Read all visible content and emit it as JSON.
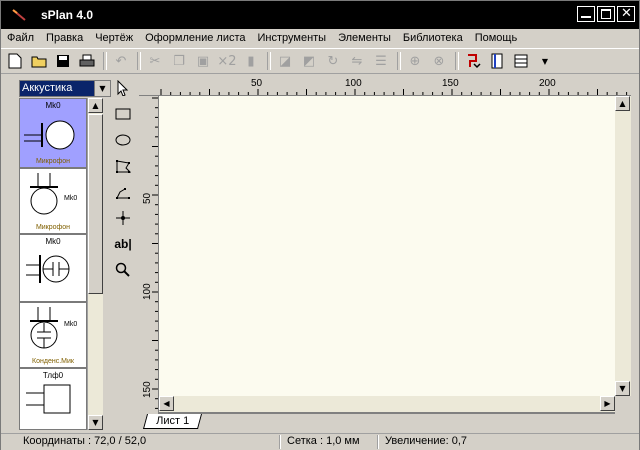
{
  "window": {
    "title": "sPlan 4.0"
  },
  "menu": [
    "Файл",
    "Правка",
    "Чертёж",
    "Оформление листа",
    "Инструменты",
    "Элементы",
    "Библиотека",
    "Помощь"
  ],
  "toolbar": {
    "icons": [
      "new-file-icon",
      "open-folder-icon",
      "save-icon",
      "print-icon",
      "undo-icon",
      "cut-icon",
      "copy-icon",
      "paste-icon",
      "duplicate-icon",
      "delete-icon",
      "bring-front-icon",
      "send-back-icon",
      "rotate-icon",
      "mirror-icon",
      "align-icon",
      "lock-icon",
      "group-icon",
      "connect-icon",
      "page-icon",
      "grid-icon",
      "dropdown-icon"
    ],
    "duplicate_label": "×2"
  },
  "library": {
    "category": "Аккустика",
    "items": [
      {
        "top": "Mk0",
        "caption": "Микрофон",
        "selected": true
      },
      {
        "side": "Mk0",
        "caption": "Микрофон"
      },
      {
        "top": "Mk0",
        "caption": ""
      },
      {
        "side": "Mk0",
        "caption": "Конденс.Мик"
      },
      {
        "top": "Тлф0",
        "caption": ""
      }
    ]
  },
  "tools": [
    "pointer-icon",
    "rectangle-icon",
    "ellipse-icon",
    "polygon-icon",
    "polyline-icon",
    "node-icon",
    "text-icon",
    "zoom-icon"
  ],
  "tools_text_label": "ab|",
  "ruler": {
    "h_labels": [
      "50",
      "100",
      "150",
      "200"
    ],
    "v_labels": [
      "50",
      "100",
      "150"
    ]
  },
  "sheet_tab": "Лист 1",
  "status": {
    "coords": "Координаты : 72,0 / 52,0",
    "grid": "Сетка : 1,0 мм",
    "zoom": "Увеличение: 0,7"
  }
}
